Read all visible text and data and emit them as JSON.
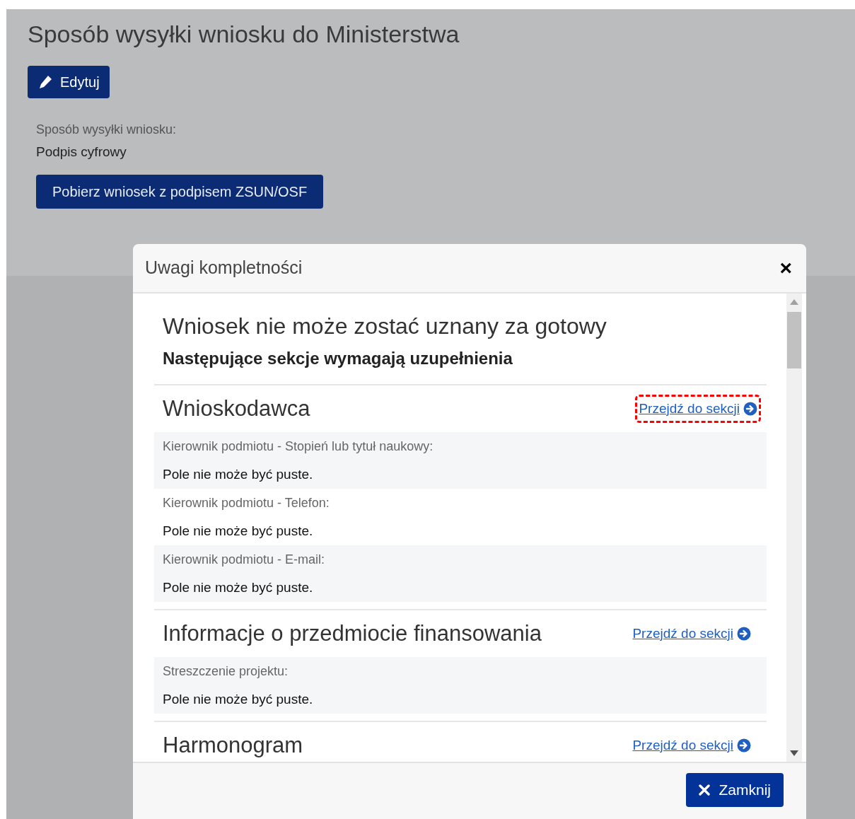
{
  "page": {
    "title": "Sposób wysyłki wniosku do Ministerstwa",
    "edit_button": "Edytuj",
    "field_label": "Sposób wysyłki wniosku:",
    "field_value": "Podpis cyfrowy",
    "download_button": "Pobierz wniosek z podpisem ZSUN/OSF"
  },
  "modal": {
    "title": "Uwagi kompletności",
    "close_icon": "×",
    "heading": "Wniosek nie może zostać uznany za gotowy",
    "subheading": "Następujące sekcje wymagają uzupełnienia",
    "sections": [
      {
        "title": "Wnioskodawca",
        "link": "Przejdź do sekcji",
        "highlighted": true,
        "issues": [
          {
            "label": "Kierownik podmiotu - Stopień lub tytuł naukowy:",
            "message": "Pole nie może być puste."
          },
          {
            "label": "Kierownik podmiotu - Telefon:",
            "message": "Pole nie może być puste."
          },
          {
            "label": "Kierownik podmiotu - E-mail:",
            "message": "Pole nie może być puste."
          }
        ]
      },
      {
        "title": "Informacje o przedmiocie finansowania",
        "link": "Przejdź do sekcji",
        "highlighted": false,
        "issues": [
          {
            "label": "Streszczenie projektu:",
            "message": "Pole nie może być puste."
          }
        ]
      },
      {
        "title": "Harmonogram",
        "link": "Przejdź do sekcji",
        "highlighted": false
      }
    ],
    "close_button": "Zamknij"
  }
}
